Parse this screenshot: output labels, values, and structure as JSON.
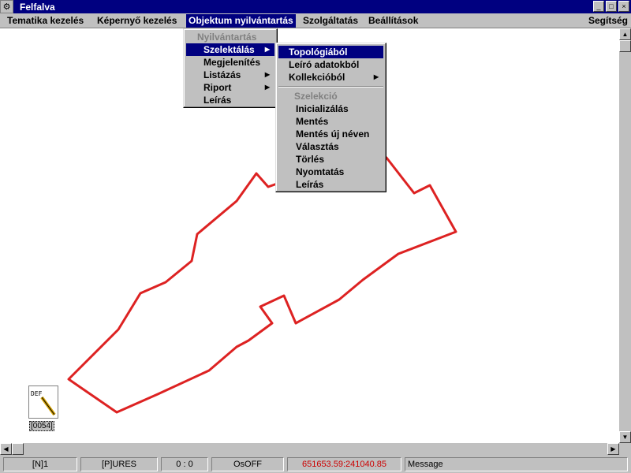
{
  "window": {
    "title": "Felfalva",
    "app_icon": "app-logo-icon"
  },
  "menubar": {
    "items": [
      {
        "label": "Tematika kezelés"
      },
      {
        "label": "Képernyő kezelés"
      },
      {
        "label": "Objektum nyilvántartás"
      },
      {
        "label": "Szolgáltatás"
      },
      {
        "label": "Beállítások"
      },
      {
        "label": "Segítség"
      }
    ]
  },
  "menu_objektum": {
    "header": "Nyilvántartás",
    "items": [
      {
        "label": "Szelektálás"
      },
      {
        "label": "Megjelenítés"
      },
      {
        "label": "Listázás"
      },
      {
        "label": "Riport"
      },
      {
        "label": "Leírás"
      }
    ]
  },
  "submenu_szelektalas": {
    "items": [
      {
        "label": "Topológiából"
      },
      {
        "label": "Leíró adatokból"
      },
      {
        "label": "Kollekcióból"
      }
    ],
    "section_header": "Szelekció",
    "section_items": [
      {
        "label": "Inicializálás"
      },
      {
        "label": "Mentés"
      },
      {
        "label": "Mentés új néven"
      },
      {
        "label": "Választás"
      },
      {
        "label": "Törlés"
      },
      {
        "label": "Nyomtatás"
      },
      {
        "label": "Leírás"
      }
    ]
  },
  "map": {
    "parcel_color": "#dd2222"
  },
  "minimized_icon": {
    "text": "DEF",
    "label": "[0054]"
  },
  "statusbar": {
    "n": "[N]1",
    "p": "[P]URES",
    "counter": "0 : 0",
    "os": "OsOFF",
    "coords": "651653.59:241040.85",
    "message": "Message"
  },
  "colors": {
    "title_bar": "#000080",
    "highlight": "#000080",
    "coords_text": "#cc0000"
  }
}
